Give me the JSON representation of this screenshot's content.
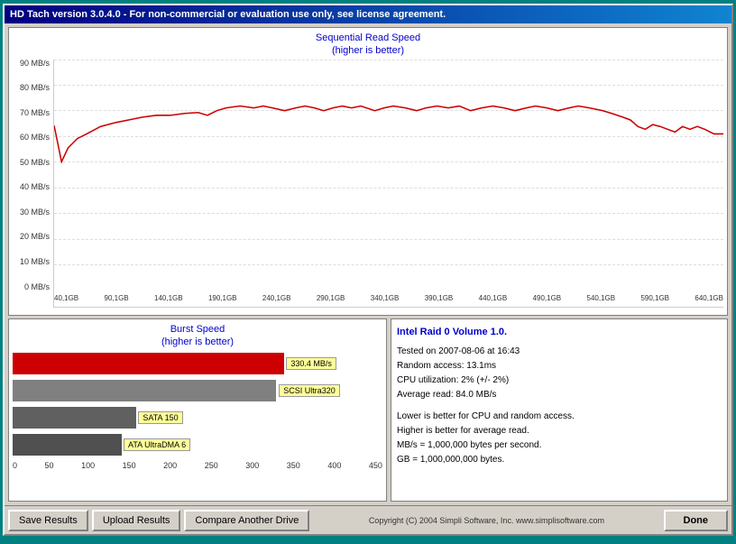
{
  "window": {
    "title": "HD Tach version 3.0.4.0  -  For non-commercial or evaluation use only, see license agreement."
  },
  "top_chart": {
    "title_line1": "Sequential Read Speed",
    "title_line2": "(higher is better)",
    "y_labels": [
      "90 MB/s",
      "80 MB/s",
      "70 MB/s",
      "60 MB/s",
      "50 MB/s",
      "40 MB/s",
      "30 MB/s",
      "20 MB/s",
      "10 MB/s",
      "0 MB/s"
    ],
    "x_labels": [
      "40,1GB",
      "90,1GB",
      "140,1GB",
      "190,1GB",
      "240,1GB",
      "290,1GB",
      "340,1GB",
      "390,1GB",
      "440,1GB",
      "490,1GB",
      "540,1GB",
      "590,1GB",
      "640,1GB"
    ]
  },
  "burst_chart": {
    "title_line1": "Burst Speed",
    "title_line2": "(higher is better)",
    "bars": [
      {
        "label": "330.4 MB/s",
        "value": 330.4,
        "color": "#cc0000"
      },
      {
        "label": "SCSI Ultra320",
        "value": 320,
        "color": "#808080"
      },
      {
        "label": "SATA 150",
        "value": 150,
        "color": "#606060"
      },
      {
        "label": "ATA UltraDMA 6",
        "value": 133,
        "color": "#505050"
      }
    ],
    "x_axis_labels": [
      "0",
      "50",
      "100",
      "150",
      "200",
      "250",
      "300",
      "350",
      "400",
      "450"
    ],
    "max_value": 450
  },
  "info": {
    "title": "Intel Raid 0 Volume 1.0.",
    "tested_on": "Tested on 2007-08-06 at 16:43",
    "random_access": "Random access: 13.1ms",
    "cpu_util": "CPU utilization: 2% (+/- 2%)",
    "avg_read": "Average read: 84.0 MB/s",
    "blank": "",
    "note1": "Lower is better for CPU and random access.",
    "note2": "Higher is better for average read.",
    "note3": "MB/s = 1,000,000 bytes per second.",
    "note4": "GB = 1,000,000,000 bytes."
  },
  "footer": {
    "save_label": "Save Results",
    "upload_label": "Upload Results",
    "compare_label": "Compare Another Drive",
    "copyright": "Copyright (C) 2004 Simpli Software, Inc. www.simplisoftware.com",
    "done_label": "Done"
  }
}
